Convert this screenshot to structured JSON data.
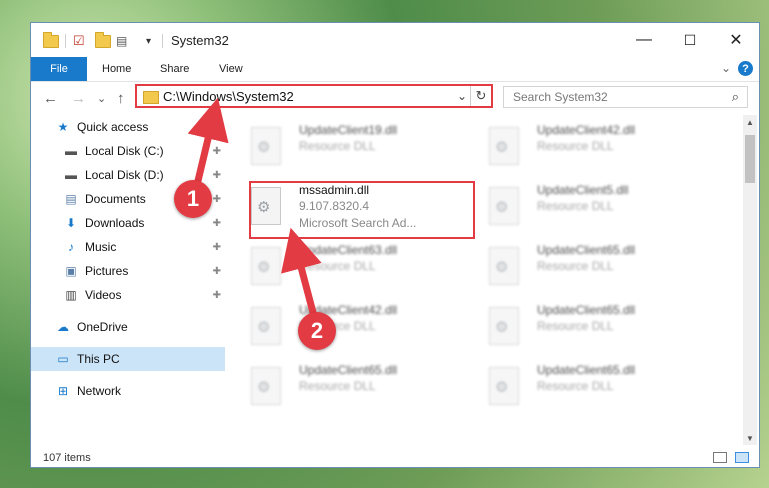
{
  "window": {
    "title": "System32",
    "controls": {
      "minimize": "—",
      "maximize": "☐",
      "close": "✕"
    }
  },
  "ribbon": {
    "tabs": [
      "File",
      "Home",
      "Share",
      "View"
    ],
    "help": "?",
    "collapse": "⌄"
  },
  "nav_buttons": {
    "back": "←",
    "forward": "→",
    "recent": "⌄",
    "up": "↑"
  },
  "address": {
    "path": "C:\\Windows\\System32",
    "dropdown": "⌄",
    "refresh": "↻"
  },
  "search": {
    "placeholder": "Search System32",
    "icon": "⌕"
  },
  "sidebar": {
    "items": [
      {
        "label": "Quick access",
        "icon": "★",
        "pinned": false
      },
      {
        "label": "Local Disk (C:)",
        "icon": "▬",
        "pinned": true
      },
      {
        "label": "Local Disk (D:)",
        "icon": "▬",
        "pinned": true
      },
      {
        "label": "Documents",
        "icon": "▤",
        "pinned": true
      },
      {
        "label": "Downloads",
        "icon": "⬇",
        "pinned": true
      },
      {
        "label": "Music",
        "icon": "♪",
        "pinned": true
      },
      {
        "label": "Pictures",
        "icon": "▣",
        "pinned": true
      },
      {
        "label": "Videos",
        "icon": "▥",
        "pinned": true
      },
      {
        "label": "OneDrive",
        "icon": "☁",
        "pinned": false
      },
      {
        "label": "This PC",
        "icon": "▭",
        "pinned": false,
        "selected": true
      },
      {
        "label": "Network",
        "icon": "⊞",
        "pinned": false
      }
    ],
    "pin_glyph": "📌"
  },
  "files": [
    {
      "name": "UpdateClient19.dll",
      "desc": "Resource DLL",
      "blurred": true
    },
    {
      "name": "UpdateClient42.dll",
      "desc": "Resource DLL",
      "blurred": true
    },
    {
      "name": "mssadmin.dll",
      "desc": "9.107.8320.4",
      "desc2": "Microsoft Search Ad...",
      "blurred": false
    },
    {
      "name": "UpdateClient5.dll",
      "desc": "Resource DLL",
      "blurred": true
    },
    {
      "name": "UpdateClient63.dll",
      "desc": "Resource DLL",
      "blurred": true
    },
    {
      "name": "UpdateClient65.dll",
      "desc": "Resource DLL",
      "blurred": true
    },
    {
      "name": "UpdateClient42.dll",
      "desc": "Resource DLL",
      "blurred": true
    },
    {
      "name": "UpdateClient65.dll",
      "desc": "Resource DLL",
      "blurred": true
    },
    {
      "name": "UpdateClient65.dll",
      "desc": "Resource DLL",
      "blurred": true
    },
    {
      "name": "UpdateClient65.dll",
      "desc": "Resource DLL",
      "blurred": true
    }
  ],
  "status": {
    "item_count": "107 items"
  },
  "annotations": {
    "step1": "1",
    "step2": "2",
    "color": "#e23b43"
  },
  "colors": {
    "accent": "#1979ca",
    "selection": "#cce4f7",
    "highlight": "#e23b43"
  }
}
